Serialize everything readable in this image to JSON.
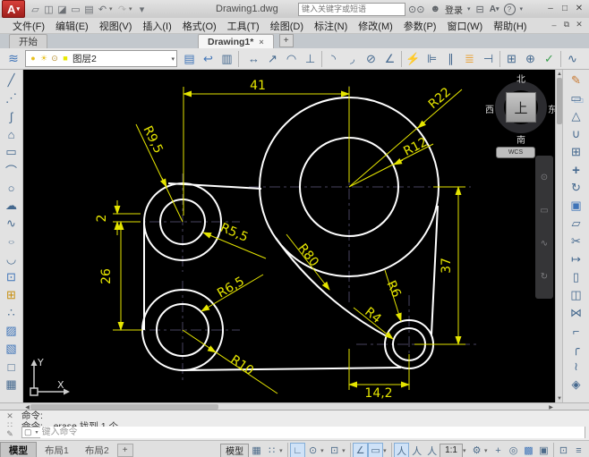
{
  "window": {
    "title": "Drawing1.dwg",
    "minimize": "–",
    "maximize": "□",
    "close": "✕"
  },
  "doc_window": {
    "minimize": "–",
    "restore": "⧉",
    "close": "✕"
  },
  "search": {
    "placeholder": "键入关键字或短语",
    "sign_in_label": "登录"
  },
  "quick_access": [
    {
      "name": "open-button",
      "glyph": "▱"
    },
    {
      "name": "save-button",
      "glyph": "◫"
    },
    {
      "name": "save-as-button",
      "glyph": "◪"
    },
    {
      "name": "new-sheet-button",
      "glyph": "▭"
    },
    {
      "name": "plot-button",
      "glyph": "▤"
    },
    {
      "name": "undo-button",
      "glyph": "↶",
      "caret": true
    },
    {
      "name": "redo-button",
      "glyph": "↷",
      "color": "#b0b0b0",
      "caret": true
    },
    {
      "name": "qat-customize-button",
      "glyph": "▾"
    }
  ],
  "menu": {
    "items": [
      {
        "name": "menu-file",
        "label": "文件(F)"
      },
      {
        "name": "menu-edit",
        "label": "编辑(E)"
      },
      {
        "name": "menu-view",
        "label": "视图(V)"
      },
      {
        "name": "menu-insert",
        "label": "插入(I)"
      },
      {
        "name": "menu-format",
        "label": "格式(O)"
      },
      {
        "name": "menu-tools",
        "label": "工具(T)"
      },
      {
        "name": "menu-draw",
        "label": "绘图(D)"
      },
      {
        "name": "menu-dimension",
        "label": "标注(N)"
      },
      {
        "name": "menu-modify",
        "label": "修改(M)"
      },
      {
        "name": "menu-parametric",
        "label": "参数(P)"
      },
      {
        "name": "menu-window",
        "label": "窗口(W)"
      },
      {
        "name": "menu-help",
        "label": "帮助(H)"
      }
    ]
  },
  "file_tabs": {
    "start": "开始",
    "drawing": "Drawing1*",
    "close": "×",
    "new": "+"
  },
  "layer_bar": {
    "current_layer": "图层2",
    "combo_icons": [
      {
        "name": "layer-on-icon",
        "glyph": "●",
        "color": "#e8c020"
      },
      {
        "name": "layer-freeze-icon",
        "glyph": "☀",
        "color": "#e8c020"
      },
      {
        "name": "layer-lock-icon",
        "glyph": "⊙",
        "color": "#b89030"
      },
      {
        "name": "layer-color-swatch",
        "glyph": "■",
        "color": "#e8e800"
      }
    ]
  },
  "layer_tools": [
    {
      "name": "layer-properties-button",
      "glyph": "▤",
      "color": "#3f74b8"
    },
    {
      "name": "layer-previous-button",
      "glyph": "↩",
      "color": "#3f74b8"
    },
    {
      "name": "layer-states-button",
      "glyph": "▥"
    }
  ],
  "dim_toolbar": [
    {
      "name": "dim-linear-button",
      "glyph": "↔"
    },
    {
      "name": "dim-aligned-button",
      "glyph": "↗"
    },
    {
      "name": "dim-arc-length-button",
      "glyph": "◠"
    },
    {
      "name": "dim-ordinate-button",
      "glyph": "⊥"
    },
    {
      "sep": true
    },
    {
      "name": "dim-radius-button",
      "glyph": "◝"
    },
    {
      "name": "dim-jogged-button",
      "glyph": "◞"
    },
    {
      "name": "dim-diameter-button",
      "glyph": "⊘"
    },
    {
      "name": "dim-angular-button",
      "glyph": "∠"
    },
    {
      "sep": true
    },
    {
      "name": "quick-dimension-button",
      "glyph": "⚡",
      "color": "#e8a33d"
    },
    {
      "name": "dim-baseline-button",
      "glyph": "⊫"
    },
    {
      "name": "dim-continue-button",
      "glyph": "∥"
    },
    {
      "name": "dim-space-button",
      "glyph": "≣",
      "color": "#e8a33d"
    },
    {
      "name": "dim-break-button",
      "glyph": "⊣"
    },
    {
      "sep": true
    },
    {
      "name": "tolerance-button",
      "glyph": "⊞"
    },
    {
      "name": "center-mark-button",
      "glyph": "⊕"
    },
    {
      "name": "dim-inspect-button",
      "glyph": "✓",
      "color": "#3a9e4e"
    },
    {
      "sep": true
    },
    {
      "name": "dim-jog-line-button",
      "glyph": "∿"
    }
  ],
  "draw_toolbar": [
    {
      "name": "line-tool",
      "glyph": "╱"
    },
    {
      "name": "construction-line-tool",
      "glyph": "⋰"
    },
    {
      "name": "polyline-tool",
      "glyph": "∫"
    },
    {
      "name": "polygon-tool",
      "glyph": "⌂"
    },
    {
      "name": "rectangle-tool",
      "glyph": "▭"
    },
    {
      "name": "arc-tool",
      "glyph": "⌒"
    },
    {
      "name": "circle-tool",
      "glyph": "○"
    },
    {
      "name": "revision-cloud-tool",
      "glyph": "☁"
    },
    {
      "name": "spline-tool",
      "glyph": "∿"
    },
    {
      "name": "ellipse-tool",
      "glyph": "○",
      "cls": "squash"
    },
    {
      "name": "ellipse-arc-tool",
      "glyph": "◡"
    },
    {
      "name": "insert-block-tool",
      "glyph": "⊡",
      "color": "#3f74b8"
    },
    {
      "name": "create-block-tool",
      "glyph": "⊞",
      "color": "#c89010"
    },
    {
      "name": "point-tool",
      "glyph": "∴"
    },
    {
      "name": "hatch-tool",
      "glyph": "▨",
      "color": "#3f74b8"
    },
    {
      "name": "gradient-tool",
      "glyph": "▧",
      "color": "#3f74b8"
    },
    {
      "name": "region-tool",
      "glyph": "□"
    },
    {
      "name": "table-tool",
      "glyph": "▦"
    }
  ],
  "modify_toolbar": [
    {
      "name": "erase-tool",
      "glyph": "✎",
      "color": "#c87830"
    },
    {
      "name": "copy-tool",
      "glyph": "▭",
      "cls": "dbl"
    },
    {
      "name": "mirror-tool",
      "glyph": "△"
    },
    {
      "name": "offset-tool",
      "glyph": "∪"
    },
    {
      "name": "array-tool",
      "glyph": "⊞"
    },
    {
      "name": "move-tool",
      "glyph": "+",
      "cls": "boldp"
    },
    {
      "name": "rotate-tool",
      "glyph": "↻"
    },
    {
      "name": "scale-tool",
      "glyph": "▣",
      "color": "#3f74b8"
    },
    {
      "name": "stretch-tool",
      "glyph": "▱"
    },
    {
      "name": "trim-tool",
      "glyph": "✂"
    },
    {
      "name": "extend-tool",
      "glyph": "↦"
    },
    {
      "name": "break-at-point-tool",
      "glyph": "▯"
    },
    {
      "name": "break-tool",
      "glyph": "◫"
    },
    {
      "name": "join-tool",
      "glyph": "⋈"
    },
    {
      "name": "chamfer-tool",
      "glyph": "⌐"
    },
    {
      "name": "fillet-tool",
      "glyph": "╭"
    },
    {
      "name": "blend-curves-tool",
      "glyph": "≀"
    },
    {
      "name": "explode-tool",
      "glyph": "◈"
    }
  ],
  "navbar_icons": [
    {
      "name": "navigation-wheel-icon",
      "glyph": "⊙"
    },
    {
      "name": "pan-icon",
      "glyph": "▭"
    },
    {
      "name": "zoom-icon",
      "glyph": "∿"
    },
    {
      "name": "orbit-icon",
      "glyph": "↻"
    }
  ],
  "viewcube": {
    "n": "北",
    "s": "南",
    "w": "西",
    "e": "东",
    "face": "上",
    "wcs": "WCS"
  },
  "ucs": {
    "x": "X",
    "y": "Y"
  },
  "command": {
    "line1": "命令:",
    "line2": "命令: _.erase 找到 1 个",
    "placeholder": "键入命令"
  },
  "layout_tabs": {
    "model": "模型",
    "layout1": "布局1",
    "layout2": "布局2",
    "new": "+"
  },
  "status": {
    "icons": [
      {
        "name": "model-paper-toggle",
        "label": "模型",
        "cls": "tbtn"
      },
      {
        "name": "grid-display-toggle",
        "glyph": "▦"
      },
      {
        "name": "snap-mode-toggle",
        "glyph": "∷",
        "caret": true
      },
      {
        "sep": true
      },
      {
        "name": "ortho-mode-toggle",
        "glyph": "∟",
        "active": true
      },
      {
        "name": "polar-tracking-toggle",
        "glyph": "⊙",
        "caret": true
      },
      {
        "name": "object-snap-toggle",
        "glyph": "⊡",
        "caret": true
      },
      {
        "sep": true
      },
      {
        "name": "lineweight-toggle",
        "glyph": "∠",
        "active": true
      },
      {
        "name": "transparency-toggle",
        "glyph": "▭",
        "active": true,
        "caret": true
      },
      {
        "sep": true
      },
      {
        "name": "annotation-visibility-toggle",
        "glyph": "人",
        "active": true
      },
      {
        "name": "annotation-autoscale-toggle",
        "glyph": "人"
      },
      {
        "name": "annotation-scale-button",
        "glyph": "人"
      },
      {
        "name": "annotation-scale-value",
        "label": "1:1",
        "cls": "tbtn",
        "caret": true
      },
      {
        "name": "workspace-switching-button",
        "glyph": "⚙",
        "caret": true
      },
      {
        "name": "annotation-monitor-button",
        "glyph": "+"
      },
      {
        "name": "isolate-objects-button",
        "glyph": "◎"
      },
      {
        "name": "hardware-acceleration-button",
        "glyph": "▩",
        "color": "#3f74b8"
      },
      {
        "name": "clean-screen-button",
        "glyph": "▣"
      },
      {
        "sep": true
      },
      {
        "name": "fullscreen-button",
        "glyph": "⊡"
      },
      {
        "name": "customization-menu-button",
        "glyph": "≡"
      }
    ]
  },
  "drawing": {
    "colors": {
      "dim": "#e5e500",
      "geometry": "#ffffff",
      "centerline": "#474360",
      "background": "#000000"
    },
    "dims": {
      "d41": "41",
      "r22": "R22",
      "r12": "R12",
      "r95": "R9,5",
      "r55": "R5,5",
      "d2": "2",
      "d26": "26",
      "r65": "R6,5",
      "r80": "R80",
      "r6": "R6",
      "r4": "R4",
      "d37": "37",
      "r10": "R10",
      "d142": "14,2"
    }
  }
}
